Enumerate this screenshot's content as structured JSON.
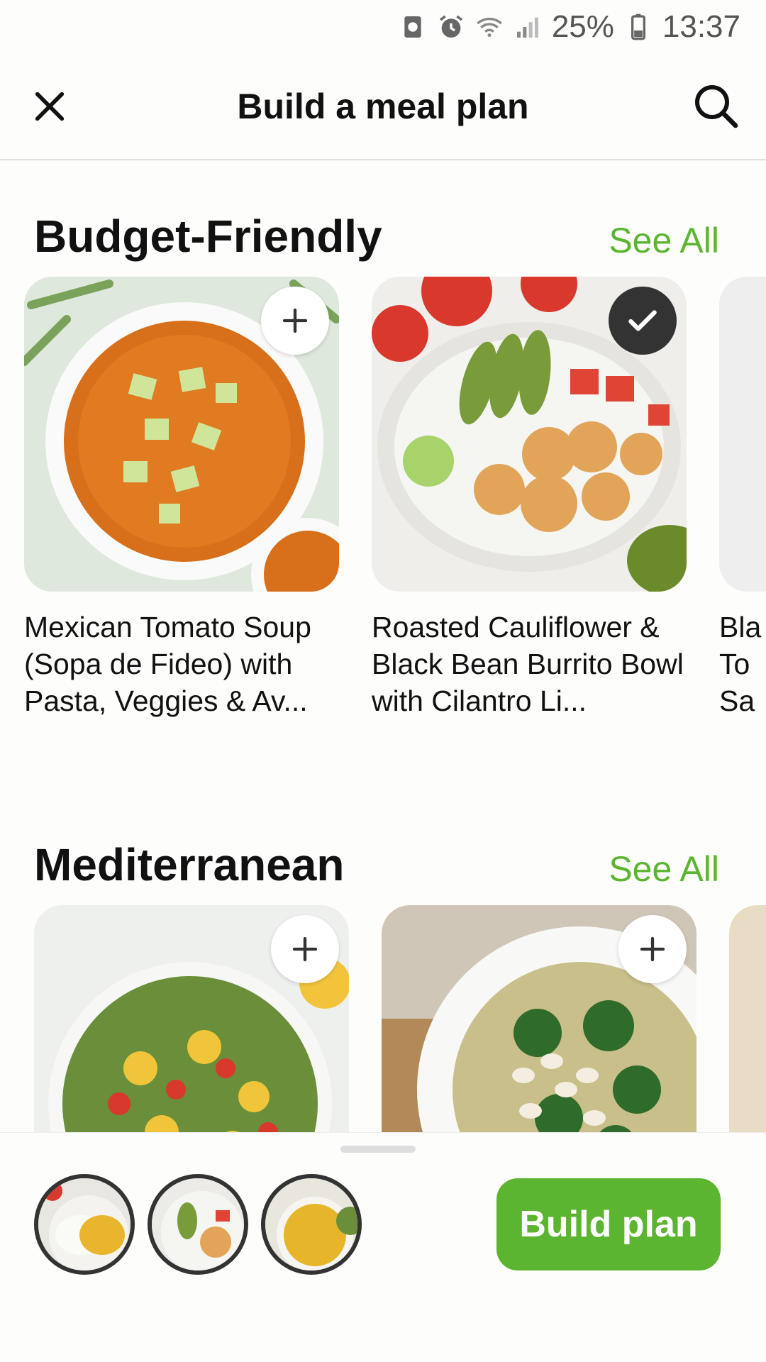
{
  "status_bar": {
    "battery": "25%",
    "time": "13:37",
    "icons": [
      "data-saver-icon",
      "alarm-icon",
      "wifi-icon",
      "signal-icon",
      "battery-icon"
    ]
  },
  "header": {
    "title": "Build a meal plan",
    "close_icon": "close-icon",
    "search_icon": "search-icon"
  },
  "sections": [
    {
      "title": "Budget-Friendly",
      "see_all": "See All",
      "cards": [
        {
          "title": "Mexican Tomato Soup (Sopa de Fideo) with Pasta, Veggies & Av...",
          "selected": false
        },
        {
          "title": "Roasted Cauliflower & Black Bean Burrito Bowl with Cilantro Li...",
          "selected": true
        },
        {
          "title": "Bla\nTo\nSa",
          "selected": false
        }
      ]
    },
    {
      "title": "Mediterranean",
      "see_all": "See All",
      "cards": [
        {
          "title": "",
          "selected": false
        },
        {
          "title": "",
          "selected": false
        }
      ]
    }
  ],
  "bottom_bar": {
    "selected_count": 3,
    "build_button": "Build plan"
  },
  "colors": {
    "accent": "#5cb531",
    "text": "#111111",
    "background": "#fdfdfb"
  }
}
